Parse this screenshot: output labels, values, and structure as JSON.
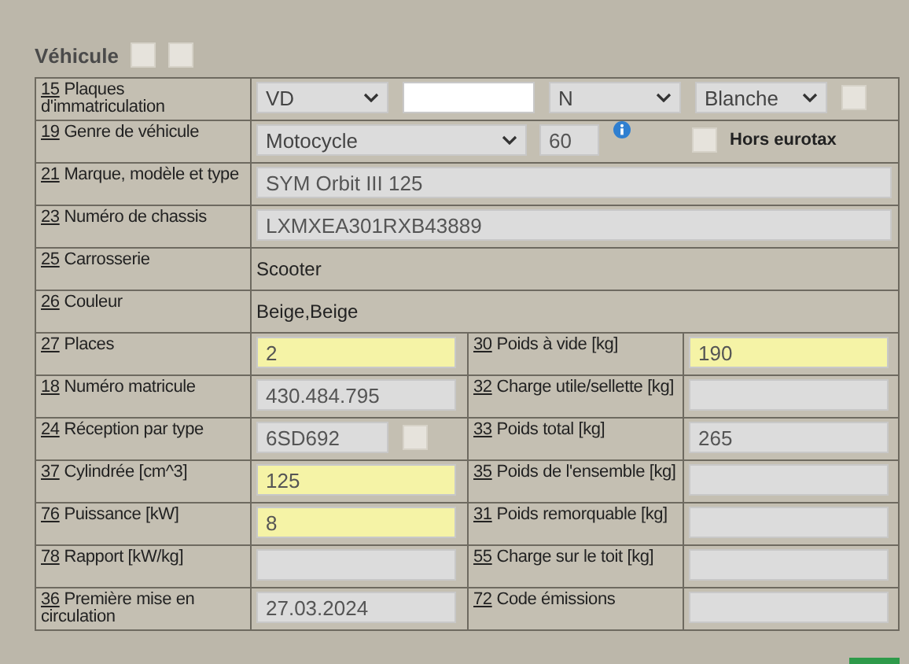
{
  "title": {
    "text": "Véhicule",
    "checkboxes": [
      {
        "checked": false
      },
      {
        "checked": false
      }
    ]
  },
  "rows": [
    {
      "kind": "plates",
      "num": "15",
      "label": "Plaques d'immatriculation",
      "canton": "VD",
      "letter": "N",
      "plate_color": "Blanche",
      "checked": false
    },
    {
      "kind": "genre",
      "num": "19",
      "label": "Genre de véhicule",
      "genre": "Motocycle",
      "code": "60",
      "eurotax": {
        "label": "Hors eurotax",
        "checked": false
      }
    },
    {
      "kind": "wide",
      "num": "21",
      "label": "Marque, modèle et type",
      "value": "SYM Orbit III 125"
    },
    {
      "kind": "wide",
      "num": "23",
      "label": "Numéro de chassis",
      "value": "LXMXEA301RXB43889"
    },
    {
      "kind": "text",
      "num": "25",
      "label": "Carrosserie",
      "value": "Scooter"
    },
    {
      "kind": "text",
      "num": "26",
      "label": "Couleur",
      "value": "Beige,Beige"
    },
    {
      "kind": "pair",
      "left": {
        "num": "27",
        "label": "Places",
        "value": "2",
        "required": true
      },
      "right": {
        "num": "30",
        "label": "Poids à vide [kg]",
        "value": "190",
        "required": true
      }
    },
    {
      "kind": "pair",
      "left": {
        "num": "18",
        "label": "Numéro matricule",
        "value": "430.484.795",
        "required": false
      },
      "right": {
        "num": "32",
        "label": "Charge utile/sellette [kg]",
        "required": false
      }
    },
    {
      "kind": "pair",
      "left": {
        "num": "24",
        "label": "Réception par type",
        "value": "6SD692",
        "required": false,
        "checkbox": {
          "checked": false
        }
      },
      "right": {
        "num": "33",
        "label": "Poids total [kg]",
        "value": "265",
        "required": false
      }
    },
    {
      "kind": "pair",
      "left": {
        "num": "37",
        "label": "Cylindrée [cm^3]",
        "value": "125",
        "required": true
      },
      "right": {
        "num": "35",
        "label": "Poids de l'ensemble [kg]",
        "required": false
      }
    },
    {
      "kind": "pair",
      "left": {
        "num": "76",
        "label": "Puissance [kW]",
        "value": "8",
        "required": true
      },
      "right": {
        "num": "31",
        "label": "Poids remorquable [kg]",
        "required": false
      }
    },
    {
      "kind": "pair",
      "left": {
        "num": "78",
        "label": "Rapport [kW/kg]",
        "required": false
      },
      "right": {
        "num": "55",
        "label": "Charge sur le toit [kg]",
        "required": false
      }
    },
    {
      "kind": "pair",
      "left": {
        "num": "36",
        "label": "Première mise en circulation",
        "value": "27.03.2024",
        "required": false
      },
      "right": {
        "num": "72",
        "label": "Code émissions",
        "required": false
      }
    }
  ]
}
